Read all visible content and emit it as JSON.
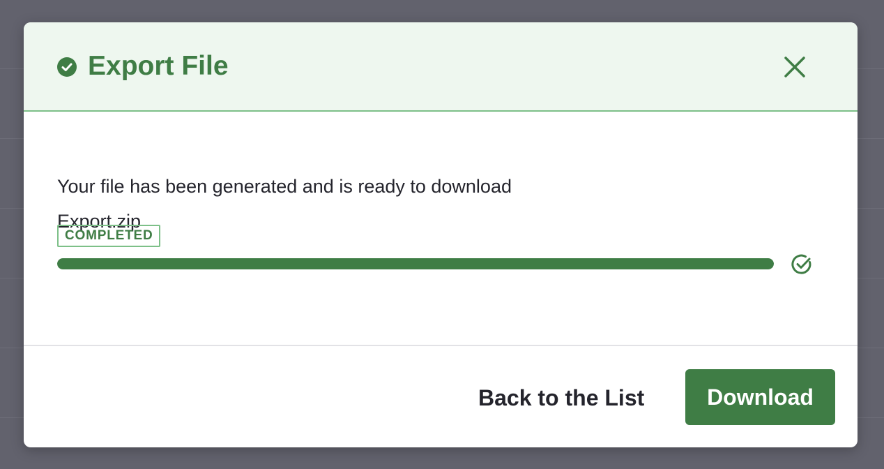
{
  "dialog": {
    "title": "Export File",
    "title_icon": "check-circle-icon",
    "close_icon": "close-icon",
    "accent_color": "#3f7d45",
    "header_bg": "#eef7ef"
  },
  "export": {
    "message": "Your file has been generated and is ready to download",
    "filename": "Export.zip",
    "status": "COMPLETED",
    "progress": 1.0,
    "progress_icon": "check-circle-outline-icon"
  },
  "footer": {
    "back_label": "Back to the List",
    "download_label": "Download"
  }
}
